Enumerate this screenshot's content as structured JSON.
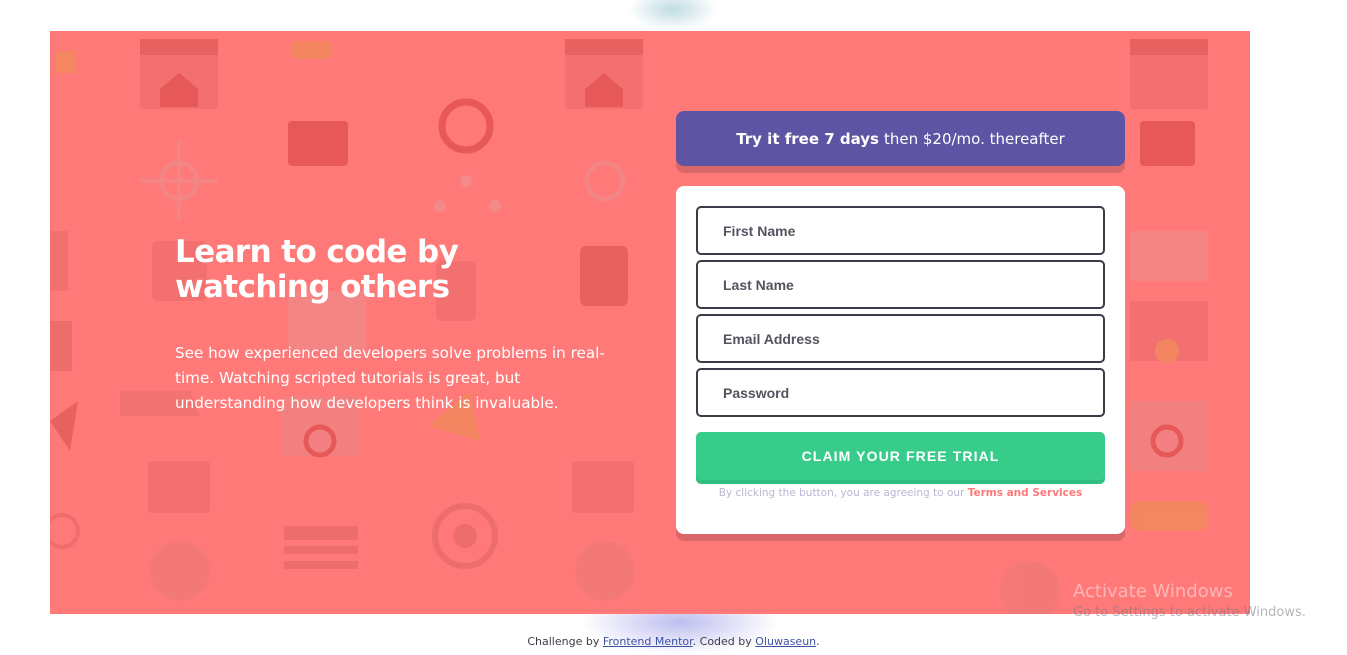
{
  "hero": {
    "headline": "Learn to code by watching others",
    "intro": "See how experienced developers solve problems in real-time. Watching scripted tutorials is great, but understanding how developers think is invaluable."
  },
  "promo": {
    "bold": "Try it free 7 days",
    "rest": "then $20/mo. thereafter"
  },
  "form": {
    "first_name_placeholder": "First Name",
    "last_name_placeholder": "Last Name",
    "email_placeholder": "Email Address",
    "password_placeholder": "Password",
    "submit_label": "CLAIM YOUR FREE TRIAL",
    "terms_prefix": "By clicking the button, you are agreeing to our",
    "terms_link": "Terms and Services"
  },
  "footer": {
    "prefix": "Challenge by",
    "mentor_link": "Frontend Mentor",
    "middle": ". Coded by",
    "author_link": "Oluwaseun",
    "suffix": "."
  },
  "os_overlay": {
    "title": "Activate Windows",
    "subtitle": "Go to Settings to activate Windows."
  },
  "colors": {
    "background": "#ff7979",
    "promo": "#5e54a4",
    "accent_green": "#38cc8b",
    "text_dark": "#3d3b48",
    "muted": "#b9b6d3"
  }
}
